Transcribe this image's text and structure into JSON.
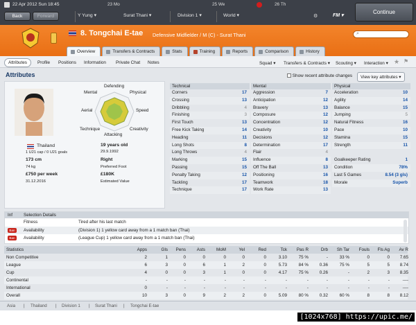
{
  "topbar": {
    "date": "22 Apr 2012",
    "day": "Sun",
    "time": "18:45",
    "back": "Back",
    "forward": "Forward",
    "nav1": "Y Yung",
    "nav2": "Surat Thani",
    "nav3": "Division 1",
    "nav4": "World",
    "mini": [
      {
        "day": "Mo",
        "date": "23"
      },
      {
        "day": "We",
        "date": "25"
      },
      {
        "day": "Th",
        "date": "26"
      }
    ],
    "fm": "FM",
    "continue": "Continue"
  },
  "player": {
    "number": "8.",
    "name": "Tongchai E-tae",
    "position": "Defensive Midfielder / M (C) - Surat Thani",
    "nationality": "Thailand",
    "caps": "1 U21 cap / 0 U21 goals",
    "age": "19 years old",
    "dob": "29.9.1992",
    "height": "173 cm",
    "foot": "Right",
    "foot_label": "Preferred Foot",
    "weight": "74 kg",
    "wage": "£750 per week",
    "value": "£180K",
    "value_label": "Estimated Value",
    "contract": "31.12.2016"
  },
  "tabs": [
    "Overview",
    "Transfers & Contracts",
    "Stats",
    "Training",
    "Reports",
    "Comparison",
    "History"
  ],
  "subtabs": [
    "Attributes",
    "Profile",
    "Positions",
    "Information",
    "Private Chat",
    "Notes"
  ],
  "subbar_right": [
    "Squad",
    "Transfers & Contracts",
    "Scouting",
    "Interaction"
  ],
  "section_title": "Attributes",
  "show_recent": "Show recent attribute changes",
  "view_key": "View key attributes",
  "radar": [
    "Defending",
    "Physical",
    "Speed",
    "Creativity",
    "Attacking",
    "Technique",
    "Aerial",
    "Mental"
  ],
  "technical": {
    "title": "Technical",
    "rows": [
      [
        "Corners",
        "17",
        ""
      ],
      [
        "Crossing",
        "13",
        ""
      ],
      [
        "Dribbling",
        "4",
        "g"
      ],
      [
        "Finishing",
        "3",
        "g"
      ],
      [
        "First Touch",
        "13",
        ""
      ],
      [
        "Free Kick Taking",
        "14",
        ""
      ],
      [
        "Heading",
        "11",
        ""
      ],
      [
        "Long Shots",
        "8",
        ""
      ],
      [
        "Long Throws",
        "4",
        "g"
      ],
      [
        "Marking",
        "15",
        ""
      ],
      [
        "Passing",
        "15",
        ""
      ],
      [
        "Penalty Taking",
        "12",
        ""
      ],
      [
        "Tackling",
        "17",
        ""
      ],
      [
        "Technique",
        "17",
        ""
      ]
    ]
  },
  "mental": {
    "title": "Mental",
    "rows": [
      [
        "Aggression",
        "7",
        ""
      ],
      [
        "Anticipation",
        "12",
        ""
      ],
      [
        "Bravery",
        "13",
        ""
      ],
      [
        "Composure",
        "12",
        ""
      ],
      [
        "Concentration",
        "12",
        ""
      ],
      [
        "Creativity",
        "10",
        ""
      ],
      [
        "Decisions",
        "12",
        ""
      ],
      [
        "Determination",
        "17",
        ""
      ],
      [
        "Flair",
        "4",
        "g"
      ],
      [
        "Influence",
        "8",
        ""
      ],
      [
        "Off The Ball",
        "13",
        ""
      ],
      [
        "Positioning",
        "16",
        ""
      ],
      [
        "Teamwork",
        "18",
        ""
      ],
      [
        "Work Rate",
        "13",
        ""
      ]
    ]
  },
  "physical": {
    "title": "Physical",
    "rows": [
      [
        "Acceleration",
        "10",
        ""
      ],
      [
        "Agility",
        "14",
        ""
      ],
      [
        "Balance",
        "15",
        ""
      ],
      [
        "Jumping",
        "5",
        "g"
      ],
      [
        "Natural Fitness",
        "16",
        ""
      ],
      [
        "Pace",
        "10",
        ""
      ],
      [
        "Stamina",
        "15",
        ""
      ],
      [
        "Strength",
        "11",
        ""
      ]
    ]
  },
  "extra": [
    [
      "Goalkeeper Rating",
      "1"
    ],
    [
      "Condition",
      "78%"
    ],
    [
      "Last 5 Games",
      "8.54 (3 gls)"
    ],
    [
      "Morale",
      "Superb"
    ]
  ],
  "selection": {
    "col1": "Inf",
    "col2": "Selection Details",
    "rows": [
      {
        "badge": "",
        "label": "Fitness",
        "text": "Tired after his last match"
      },
      {
        "badge": "Ban",
        "label": "Availability",
        "text": "(Division 1) 1 yellow card away from a 1 match ban (Thai)"
      },
      {
        "badge": "Ban",
        "label": "Availability",
        "text": "(League Cup) 1 yellow card away from a 1 match ban (Thai)"
      }
    ]
  },
  "stats": {
    "headers": [
      "Statistics",
      "Apps",
      "Gls",
      "Pens",
      "Asts",
      "MoM",
      "Yel",
      "Red",
      "Tck",
      "Pas R",
      "Drb",
      "Sh Tar",
      "Fouls",
      "Fls Ag",
      "Av R"
    ],
    "rows": [
      [
        "Non Competitive",
        "2",
        "1",
        "0",
        "0",
        "0",
        "0",
        "0",
        "3.10",
        "75 %",
        "-",
        "33 %",
        "0",
        "0",
        "7.65"
      ],
      [
        "League",
        "6",
        "3",
        "0",
        "6",
        "1",
        "2",
        "0",
        "5.73",
        "84 %",
        "0.36",
        "75 %",
        "5",
        "5",
        "8.74"
      ],
      [
        "Cup",
        "4",
        "0",
        "0",
        "3",
        "1",
        "0",
        "0",
        "4.17",
        "75 %",
        "0.26",
        "-",
        "2",
        "3",
        "8.35"
      ],
      [
        "Continental",
        "-",
        "-",
        "-",
        "-",
        "-",
        "-",
        "-",
        "-",
        "-",
        "-",
        "-",
        "-",
        "-",
        "----"
      ],
      [
        "International",
        "0",
        "-",
        "-",
        "-",
        "-",
        "-",
        "-",
        "-",
        "-",
        "-",
        "-",
        "-",
        "-",
        "----"
      ],
      [
        "Overall",
        "10",
        "3",
        "0",
        "9",
        "2",
        "2",
        "0",
        "5.09",
        "80 %",
        "0.32",
        "60 %",
        "8",
        "8",
        "8.12"
      ]
    ]
  },
  "footer": [
    "Asia",
    "Thailand",
    "Division 1",
    "Surat Thani",
    "Tongchai E-tae"
  ],
  "watermark": "[1024x768] https://upic.me/",
  "colors": {
    "orange": "#ef7a20",
    "dark": "#3c4048",
    "blue": "#1452a8"
  }
}
